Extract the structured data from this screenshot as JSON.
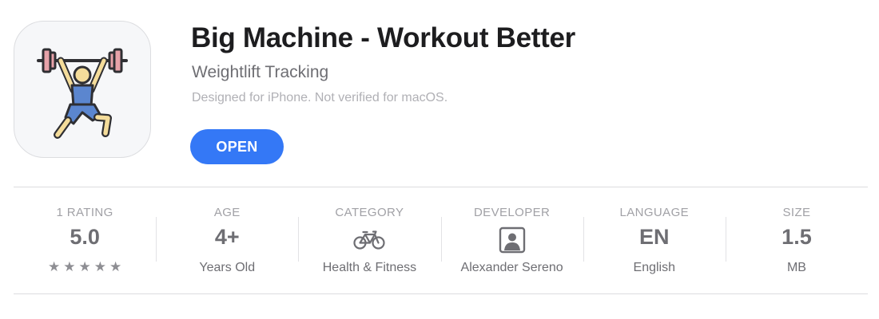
{
  "app": {
    "title": "Big Machine - Workout Better",
    "subtitle": "Weightlift Tracking",
    "compatibility_note": "Designed for iPhone. Not verified for macOS.",
    "open_label": "OPEN",
    "icon": "weightlifter-icon"
  },
  "colors": {
    "accent": "#3478f6",
    "icon_blue": "#5b86cf",
    "icon_skin": "#f4dc9a",
    "icon_plate": "#e7a2a9"
  },
  "stats": {
    "rating": {
      "label": "1 RATING",
      "value": "5.0",
      "stars": [
        "★",
        "★",
        "★",
        "★",
        "★"
      ],
      "star_count": 5
    },
    "age": {
      "label": "AGE",
      "value": "4+",
      "sub": "Years Old"
    },
    "category": {
      "label": "CATEGORY",
      "icon": "bicycle-icon",
      "sub": "Health & Fitness"
    },
    "developer": {
      "label": "DEVELOPER",
      "icon": "person-portrait-icon",
      "sub": "Alexander Sereno"
    },
    "language": {
      "label": "LANGUAGE",
      "value": "EN",
      "sub": "English"
    },
    "size": {
      "label": "SIZE",
      "value": "1.5",
      "sub": "MB"
    }
  }
}
